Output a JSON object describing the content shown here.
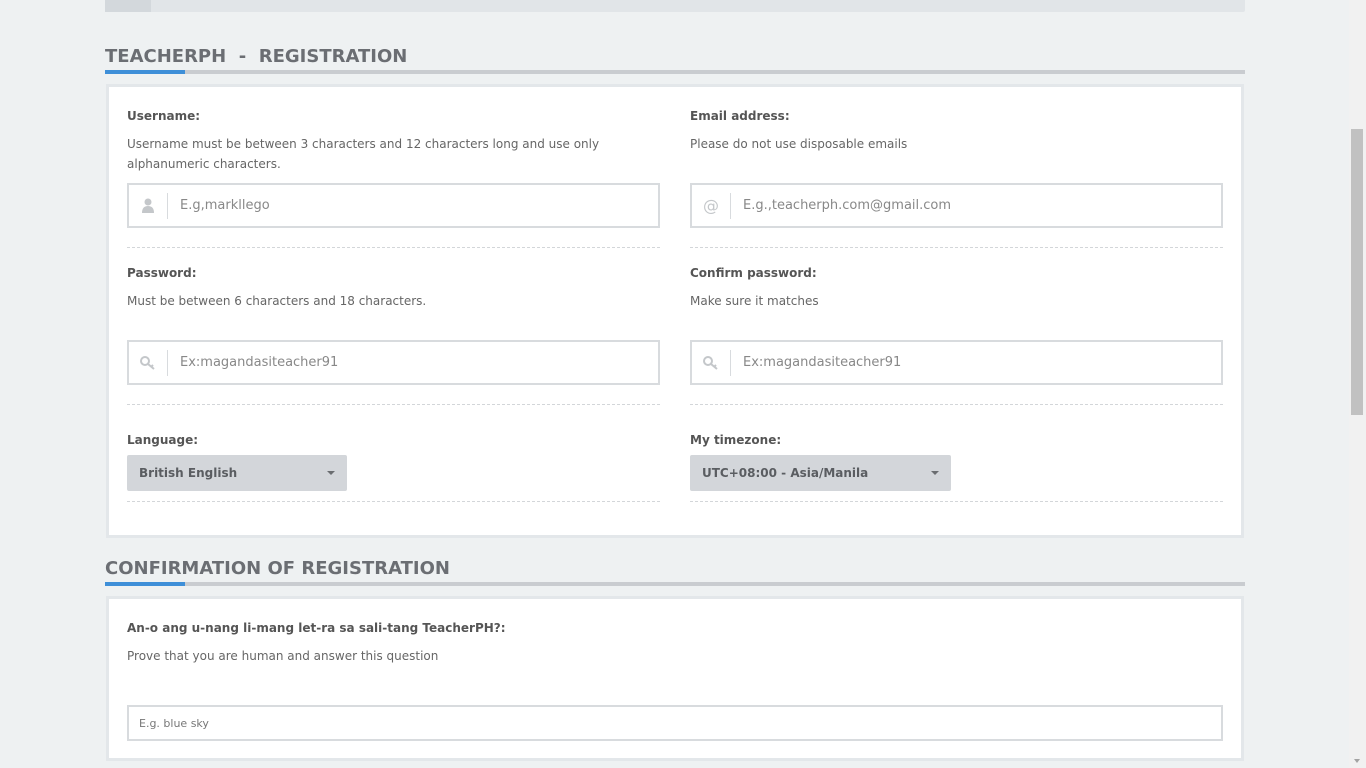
{
  "registration": {
    "title": "TEACHERPH  -  REGISTRATION",
    "username": {
      "label": "Username:",
      "hint": "Username must be between 3 characters and 12 characters long and use only alphanumeric characters.",
      "placeholder": "E.g,markllego",
      "icon": "user-icon"
    },
    "email": {
      "label": "Email address:",
      "hint": "Please do not use disposable emails",
      "placeholder": "E.g.,teacherph.com@gmail.com",
      "icon": "at-icon"
    },
    "password": {
      "label": "Password:",
      "hint": "Must be between 6 characters and 18 characters.",
      "placeholder": "Ex:magandasiteacher91",
      "icon": "key-icon"
    },
    "confirm_password": {
      "label": "Confirm password:",
      "hint": "Make sure it matches",
      "placeholder": "Ex:magandasiteacher91",
      "icon": "key-icon"
    },
    "language": {
      "label": "Language:",
      "selected": "British English"
    },
    "timezone": {
      "label": "My timezone:",
      "selected": "UTC+08:00 - Asia/Manila"
    }
  },
  "confirmation": {
    "title": "CONFIRMATION OF REGISTRATION",
    "question": {
      "label": "An-o ang u-nang li-mang let-ra sa sali-tang TeacherPH?:",
      "hint": "Prove that you are human and answer this question",
      "placeholder": "E.g. blue sky"
    }
  },
  "colors": {
    "accent": "#3e8fd8",
    "page_bg": "#eef1f2"
  }
}
